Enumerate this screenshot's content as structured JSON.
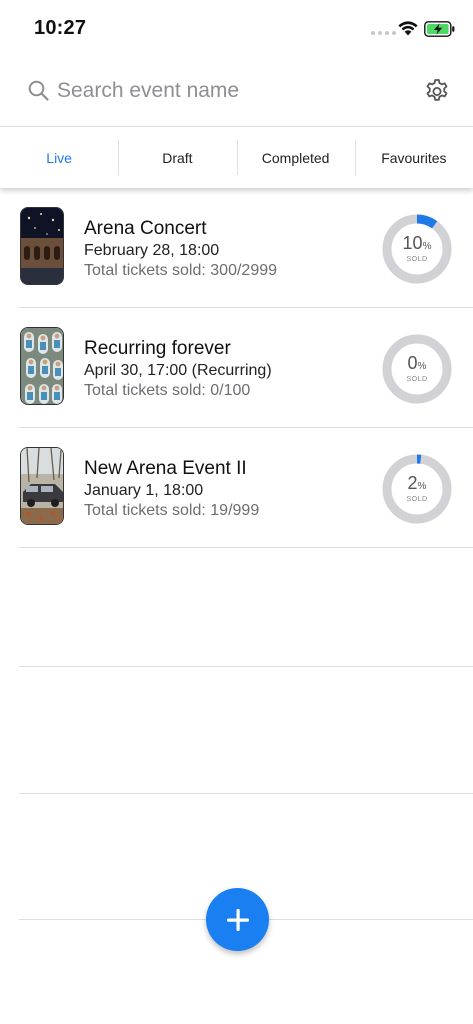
{
  "status_bar": {
    "time": "10:27"
  },
  "search": {
    "placeholder": "Search event name"
  },
  "tabs": [
    {
      "label": "Live",
      "active": true
    },
    {
      "label": "Draft",
      "active": false
    },
    {
      "label": "Completed",
      "active": false
    },
    {
      "label": "Favourites",
      "active": false
    }
  ],
  "events": [
    {
      "title": "Arena Concert",
      "date": "February 28, 18:00",
      "sold": "Total tickets sold: 300/2999",
      "percent": "10",
      "percent_unit": "%",
      "sold_label": "SOLD",
      "fraction": 0.1
    },
    {
      "title": "Recurring forever",
      "date": "April 30, 17:00 (Recurring)",
      "sold": "Total tickets sold: 0/100",
      "percent": "0",
      "percent_unit": "%",
      "sold_label": "SOLD",
      "fraction": 0.0
    },
    {
      "title": "New Arena Event II",
      "date": "January 1, 18:00",
      "sold": "Total tickets sold: 19/999",
      "percent": "2",
      "percent_unit": "%",
      "sold_label": "SOLD",
      "fraction": 0.02
    }
  ],
  "colors": {
    "accent": "#1f7ae8",
    "ring_track": "#d1d1d6",
    "fab": "#1a7ff0"
  },
  "icons": {
    "search": "search-icon",
    "settings": "gear-icon",
    "add": "plus-icon"
  }
}
